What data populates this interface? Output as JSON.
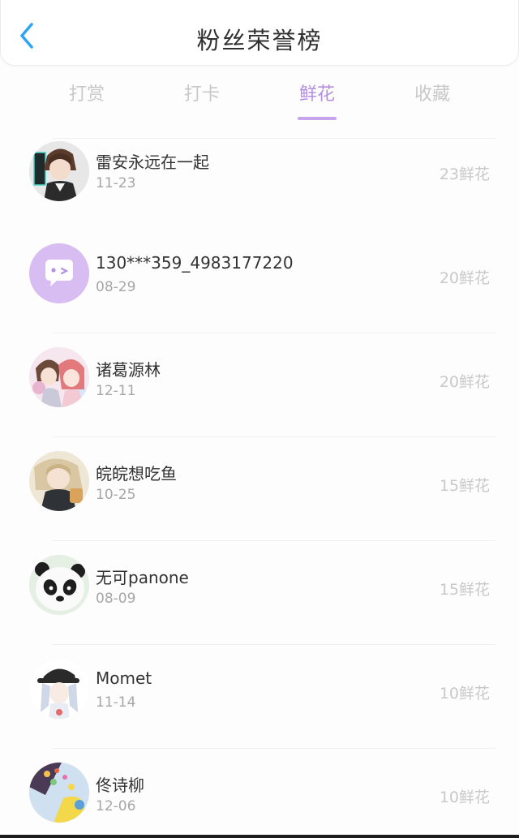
{
  "header": {
    "title": "粉丝荣誉榜",
    "back_icon": "chevron-left-icon",
    "accent_color": "#2fa4f5"
  },
  "tabs": [
    {
      "label": "打赏",
      "active": false
    },
    {
      "label": "打卡",
      "active": false
    },
    {
      "label": "鲜花",
      "active": true
    },
    {
      "label": "收藏",
      "active": false
    }
  ],
  "active_tab_color": "#b48ee0",
  "fans": [
    {
      "name": "雷安永远在一起",
      "date": "11-23",
      "count": "23鲜花",
      "avatar": "anime-boy-avatar"
    },
    {
      "name": "130***359_4983177220",
      "date": "08-29",
      "count": "20鲜花",
      "avatar": "default-chat-avatar"
    },
    {
      "name": "诸葛源林",
      "date": "12-11",
      "count": "20鲜花",
      "avatar": "anime-pair-avatar"
    },
    {
      "name": "皖皖想吃鱼",
      "date": "10-25",
      "count": "15鲜花",
      "avatar": "anime-girl-avatar"
    },
    {
      "name": "无可panone",
      "date": "08-09",
      "count": "15鲜花",
      "avatar": "panda-avatar"
    },
    {
      "name": "Momet",
      "date": "11-14",
      "count": "10鲜花",
      "avatar": "cap-girl-avatar"
    },
    {
      "name": "佟诗柳",
      "date": "12-06",
      "count": "10鲜花",
      "avatar": "colorful-avatar"
    }
  ]
}
